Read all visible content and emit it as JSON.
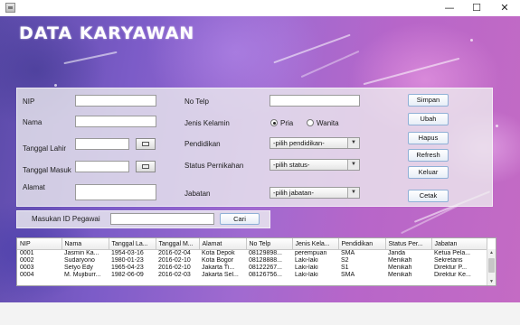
{
  "window": {
    "minimize_glyph": "—",
    "maximize_glyph": "☐",
    "close_glyph": "✕"
  },
  "header": {
    "title": "DATA KARYAWAN"
  },
  "form": {
    "nip_label": "NIP",
    "nama_label": "Nama",
    "tanggal_lahir_label": "Tanggal Lahir",
    "tanggal_masuk_label": "Tanggal Masuk",
    "alamat_label": "Alamat",
    "no_telp_label": "No Telp",
    "jenis_kelamin_label": "Jenis Kelamin",
    "radio_pria": "Pria",
    "radio_wanita": "Wanita",
    "selected_gender": "Pria",
    "pendidikan_label": "Pendidikan",
    "pendidikan_value": "-pilih pendidikan-",
    "status_label": "Status Pernikahan",
    "status_value": "-pilih status-",
    "jabatan_label": "Jabatan",
    "jabatan_value": "-pilih jabatan-"
  },
  "buttons": {
    "simpan": "Simpan",
    "ubah": "Ubah",
    "hapus": "Hapus",
    "refresh": "Refresh",
    "keluar": "Keluar",
    "cetak": "Cetak"
  },
  "search": {
    "label": "Masukan ID Pegawai",
    "value": "",
    "button": "Cari"
  },
  "table": {
    "columns": [
      "NIP",
      "Nama",
      "Tanggal La...",
      "Tanggal M...",
      "Alamat",
      "No Telp",
      "Jenis Kela...",
      "Pendidikan",
      "Status Per...",
      "Jabatan"
    ],
    "rows": [
      [
        "0001",
        "Jasmin Ka...",
        "1954-03-16",
        "2016-02-04",
        "Kota Depok",
        "08129898...",
        "perempuan",
        "SMA",
        "Janda",
        "Ketua Pela..."
      ],
      [
        "0002",
        "Sudaryono",
        "1980-01-23",
        "2016-02-10",
        "Kota Bogor",
        "08128888...",
        "Laki-laki",
        "S2",
        "Menikah",
        "Sekretaris"
      ],
      [
        "0003",
        "Setyo Edy",
        "1965-04-23",
        "2016-02-10",
        "Jakarta Ti...",
        "08122267...",
        "Laki-laki",
        "S1",
        "Menikah",
        "Direktur P..."
      ],
      [
        "0004",
        "M. Mujiburr...",
        "1982-06-09",
        "2016-02-03",
        "Jakarta Sel...",
        "08126756...",
        "Laki-laki",
        "SMA",
        "Menikah",
        "Direktur Ke..."
      ]
    ]
  },
  "icons": {
    "app": "app-window-icon",
    "date_picker": "calendar-icon",
    "combo_arrow": "chevron-down-icon"
  }
}
